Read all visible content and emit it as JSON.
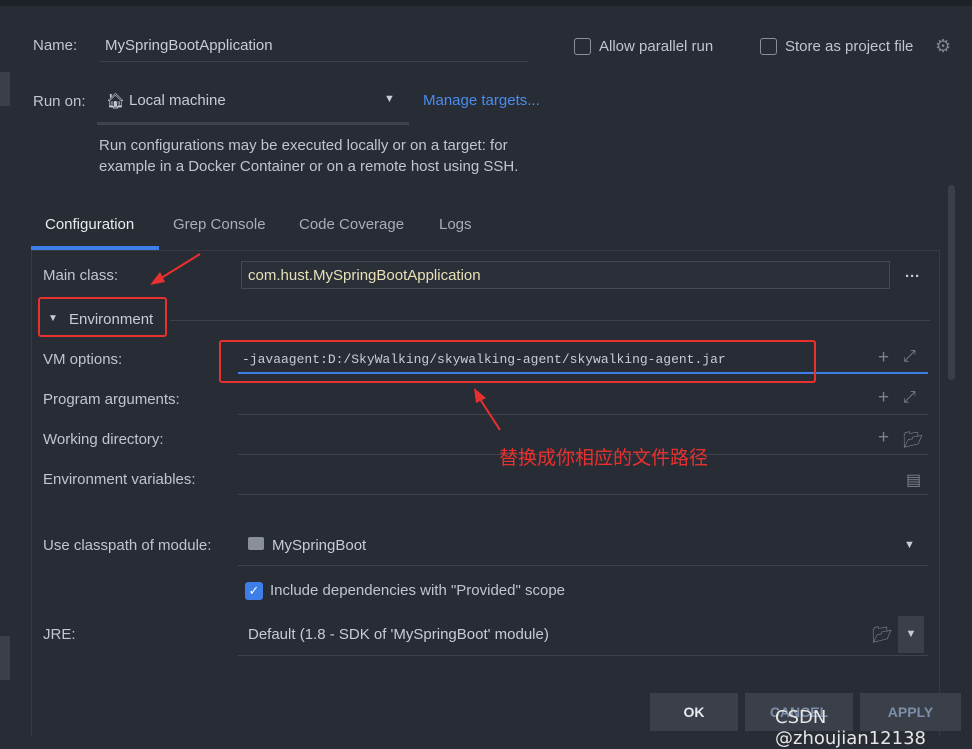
{
  "name": {
    "label": "Name:",
    "value": "MySpringBootApplication"
  },
  "allow_parallel": {
    "label": "Allow parallel run",
    "checked": false
  },
  "store_project": {
    "label": "Store as project file",
    "checked": false
  },
  "run_on": {
    "label": "Run on:",
    "value": "Local machine",
    "manage": "Manage targets...",
    "hint1": "Run configurations may be executed locally or on a target: for",
    "hint2": "example in a Docker Container or on a remote host using SSH."
  },
  "tabs": [
    "Configuration",
    "Grep Console",
    "Code Coverage",
    "Logs"
  ],
  "active_tab": "Configuration",
  "main_class": {
    "label": "Main class:",
    "value": "com.hust.MySpringBootApplication"
  },
  "environment": "Environment",
  "vm_options": {
    "label": "VM options:",
    "value": "-javaagent:D:/SkyWalking/skywalking-agent/skywalking-agent.jar"
  },
  "program_args": {
    "label": "Program arguments:"
  },
  "working_dir": {
    "label": "Working directory:"
  },
  "env_vars": {
    "label": "Environment variables:"
  },
  "annotation": "替换成你相应的文件路径",
  "classpath": {
    "label": "Use classpath of module:",
    "value": "MySpringBoot"
  },
  "include_deps": {
    "label": "Include dependencies with \"Provided\" scope",
    "checked": true
  },
  "jre": {
    "label": "JRE:",
    "value": "Default (1.8 - SDK of 'MySpringBoot' module)"
  },
  "buttons": {
    "ok": "OK",
    "cancel": "CANCEL",
    "apply": "APPLY"
  },
  "watermark": "CSDN @zhoujian12138",
  "colors": {
    "accent": "#3d7ee8",
    "annotation": "#e8312f",
    "link": "#4a8cf0"
  }
}
